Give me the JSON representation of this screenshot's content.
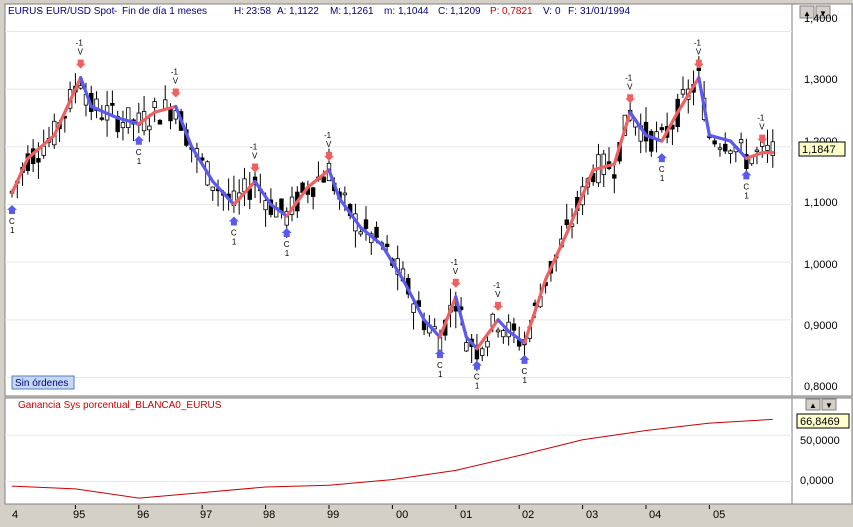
{
  "header": {
    "symbol": "EURUS",
    "name": "EUR/USD Spot",
    "period": "Fin de día 1 meses",
    "H_label": "H:",
    "H": "23:58",
    "A_label": "A:",
    "A": "1,1122",
    "M_label": "M:",
    "M": "1,1261",
    "m_label": "m:",
    "m": "1,1044",
    "C_label": "C:",
    "C": "1,1209",
    "P_label": "P:",
    "P": "0,7821",
    "V_label": "V:",
    "V": "0",
    "F_label": "F:",
    "F": "31/01/1994"
  },
  "window_buttons": [
    "▲",
    "▼"
  ],
  "orders_label": "Sin órdenes",
  "price_axis": {
    "ticks": [
      "1,4000",
      "1,3000",
      "1,2000",
      "1,1000",
      "1,0000",
      "0,9000",
      "0,8000"
    ],
    "last_value": "1,1847"
  },
  "indicator": {
    "title": "Ganancia Sys porcentual_BLANCA0_EURUS",
    "ticks": [
      "50,0000",
      "0,0000"
    ],
    "last_value": "66,8469"
  },
  "x_axis": {
    "ticks": [
      "4",
      "95",
      "96",
      "97",
      "98",
      "99",
      "00",
      "01",
      "02",
      "03",
      "04",
      "05"
    ]
  },
  "colors": {
    "long_line": "#f06060",
    "short_line": "#5a5aee",
    "profit_line": "#cc0000",
    "buy_arrow": "#5a5aee",
    "sell_arrow": "#f06060",
    "last_arrow": "#44aa44"
  },
  "signal_labels": {
    "buy": [
      "C",
      "1"
    ],
    "sell": [
      "-1",
      "V"
    ]
  },
  "chart_data": {
    "type": "line",
    "series": [
      {
        "x": [
          "1994-01",
          "1994-04",
          "1994-09",
          "1995-02",
          "1995-04",
          "1995-09",
          "1996-01",
          "1996-04",
          "1996-08",
          "1996-11",
          "1997-03",
          "1997-07",
          "1997-11",
          "1998-02",
          "1998-05",
          "1998-09",
          "1999-01",
          "1999-03",
          "1999-07",
          "1999-11",
          "2000-03",
          "2000-07",
          "2000-10",
          "2001-01",
          "2001-03",
          "2001-05",
          "2001-09",
          "2001-11",
          "2002-02",
          "2002-06",
          "2002-10",
          "2003-03",
          "2003-07",
          "2003-10",
          "2004-01",
          "2004-04",
          "2004-07",
          "2004-11",
          "2005-01",
          "2005-05",
          "2005-08",
          "2005-11",
          "2006-01"
        ],
        "y": [
          1.12,
          1.18,
          1.22,
          1.32,
          1.27,
          1.25,
          1.24,
          1.26,
          1.27,
          1.2,
          1.14,
          1.1,
          1.14,
          1.1,
          1.08,
          1.13,
          1.16,
          1.11,
          1.06,
          1.03,
          0.97,
          0.9,
          0.87,
          0.94,
          0.87,
          0.85,
          0.9,
          0.88,
          0.86,
          0.97,
          1.05,
          1.16,
          1.17,
          1.26,
          1.22,
          1.21,
          1.26,
          1.32,
          1.22,
          1.21,
          1.18,
          1.19,
          1.19
        ]
      }
    ],
    "ylim": [
      0.78,
      1.42
    ],
    "indicator_series": {
      "name": "Ganancia Sys porcentual_BLANCA0_EURUS",
      "x": [
        "1994",
        "1995",
        "1996",
        "1997",
        "1998",
        "1999",
        "2000",
        "2001",
        "2002",
        "2003",
        "2004",
        "2005",
        "2006"
      ],
      "y": [
        -5,
        -8,
        -18,
        -12,
        -6,
        -4,
        2,
        12,
        28,
        45,
        55,
        63,
        67
      ],
      "ylim": [
        -20,
        75
      ]
    }
  }
}
